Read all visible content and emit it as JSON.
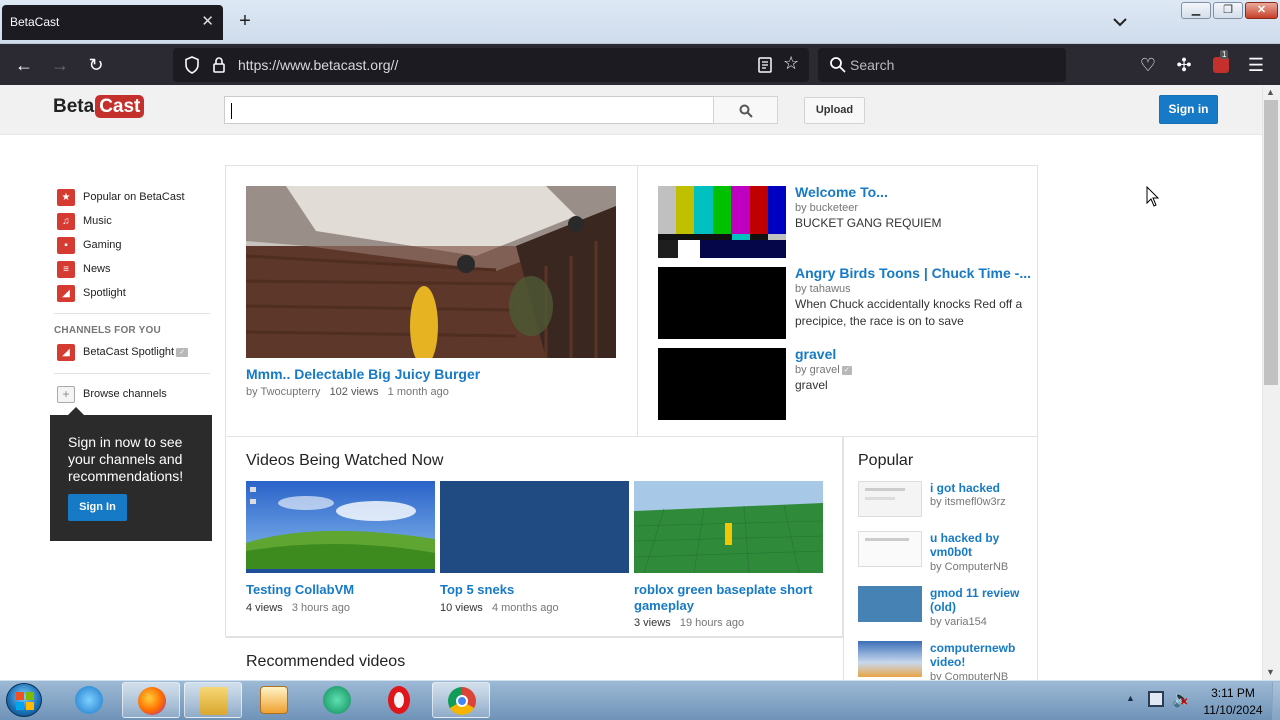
{
  "browser": {
    "tab_title": "BetaCast",
    "url_host": "https://www.betacast.org//",
    "search_placeholder": "Search",
    "extension_badge": "1"
  },
  "site": {
    "logo_beta": "Beta",
    "logo_cast": "Cast",
    "search_value": "",
    "upload_label": "Upload",
    "signin_label": "Sign in"
  },
  "guide": {
    "items": [
      {
        "label": "Popular on BetaCast",
        "icon": "star-icon"
      },
      {
        "label": "Music",
        "icon": "headphones-icon"
      },
      {
        "label": "Gaming",
        "icon": "gamepad-icon"
      },
      {
        "label": "News",
        "icon": "newspaper-icon"
      },
      {
        "label": "Spotlight",
        "icon": "spotlight-icon"
      }
    ],
    "channels_heading": "CHANNELS FOR YOU",
    "channel_item": "BetaCast Spotlight",
    "browse_label": "Browse channels",
    "promo_text": "Sign in now to see your channels and recommendations!",
    "promo_button": "Sign In"
  },
  "featured": {
    "title": "Mmm.. Delectable Big Juicy Burger",
    "by": "by Twocupterry",
    "views": "102 views",
    "age": "1 month ago"
  },
  "side_videos": [
    {
      "title": "Welcome To...",
      "by": "by bucketeer",
      "desc": "BUCKET GANG REQUIEM"
    },
    {
      "title": "Angry Birds Toons | Chuck Time -...",
      "by": "by tahawus",
      "desc": "When Chuck accidentally knocks Red off a precipice, the race is on to save"
    },
    {
      "title": "gravel",
      "by": "by gravel",
      "desc": "gravel"
    }
  ],
  "watched": {
    "heading": "Videos Being Watched Now",
    "videos": [
      {
        "title": "Testing CollabVM",
        "views": "4 views",
        "age": "3 hours ago"
      },
      {
        "title": "Top 5 sneks",
        "views": "10 views",
        "age": "4 months ago"
      },
      {
        "title": "roblox green baseplate short gameplay",
        "views": "3 views",
        "age": "19 hours ago"
      }
    ]
  },
  "recommended_heading": "Recommended videos",
  "popular": {
    "heading": "Popular",
    "items": [
      {
        "title": "i got hacked",
        "by": "by itsmefl0w3rz"
      },
      {
        "title": "u hacked by vm0b0t",
        "by": "by ComputerNB"
      },
      {
        "title": "gmod 11 review (old)",
        "by": "by varia154"
      },
      {
        "title": "computernewb video!",
        "by": "by ComputerNB"
      }
    ]
  },
  "taskbar": {
    "time": "3:11 PM",
    "date": "11/10/2024"
  },
  "colors": {
    "link": "#167ac6",
    "brand_red": "#c4302b",
    "browser_dark": "#2b2a33"
  }
}
